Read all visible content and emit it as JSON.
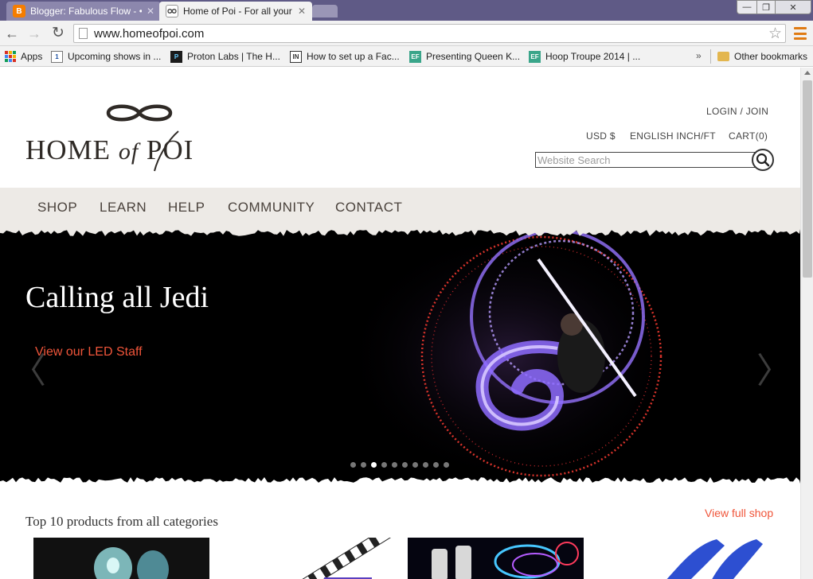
{
  "browser": {
    "tabs": [
      {
        "title": "Blogger: Fabulous Flow - •",
        "favicon": "blogger-icon",
        "active": false
      },
      {
        "title": "Home of Poi - For all your",
        "favicon": "homeofpoi-icon",
        "active": true
      }
    ],
    "address": "www.homeofpoi.com",
    "bookmarks": [
      {
        "label": "Apps",
        "icon": "apps-grid-icon"
      },
      {
        "label": "Upcoming shows in ...",
        "icon": "calendar-icon"
      },
      {
        "label": "Proton Labs | The H...",
        "icon": "proton-icon"
      },
      {
        "label": "How to set up a Fac...",
        "icon": "in-icon"
      },
      {
        "label": "Presenting Queen K...",
        "icon": "ef-icon"
      },
      {
        "label": "Hoop Troupe 2014 | ...",
        "icon": "ef-icon"
      }
    ],
    "bookmarks_overflow": "»",
    "other_bookmarks": "Other bookmarks"
  },
  "site": {
    "logo": {
      "word1": "HOME",
      "word2": "of",
      "word3": "POI"
    },
    "header_links": {
      "login": "LOGIN / JOIN",
      "currency": "USD $",
      "units": "ENGLISH INCH/FT",
      "cart": "CART(0)"
    },
    "search_placeholder": "Website Search",
    "nav": [
      "SHOP",
      "LEARN",
      "HELP",
      "COMMUNITY",
      "CONTACT"
    ],
    "hero": {
      "title": "Calling all Jedi",
      "link": "View our LED Staff",
      "slide_count": 10,
      "active_slide": 2
    },
    "products": {
      "title": "Top 10 products from all categories",
      "view_all": "View full shop"
    }
  },
  "colors": {
    "accent": "#f0553a",
    "nav_bg": "#edeae6",
    "logo": "#2f2a26"
  }
}
